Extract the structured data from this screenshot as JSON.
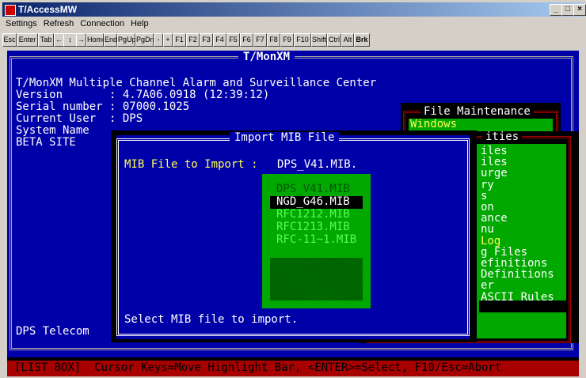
{
  "window": {
    "title": "T/AccessMW",
    "minimize": "_",
    "maximize": "□",
    "close": "×"
  },
  "menu": [
    "Settings",
    "Refresh",
    "Connection",
    "Help"
  ],
  "keys": [
    "Esc",
    "Enter",
    "Tab",
    "←",
    "↕",
    "→",
    "Home",
    "End",
    "PgUp",
    "PgDn",
    "-",
    "+",
    "F1",
    "F2",
    "F3",
    "F4",
    "F5",
    "F6",
    "F7",
    "F8",
    "F9",
    "F10",
    "Shift",
    "Ctrl",
    "Alt",
    "Brk"
  ],
  "screen": {
    "title": "T/MonXM",
    "header": "T/MonXM Multiple Channel Alarm and Surveillance Center",
    "version_label": "Version       : 4.7A06.0918 (12:39:12)",
    "serial_label": "Serial number : 07000.1025",
    "user_label": "Current User  : DPS",
    "system_label": "System Name",
    "site": "BETA SITE",
    "company": "DPS Telecom",
    "status_bar": "[LIST BOX]  Cursor Keys=Move Highlight Bar, <ENTER>=Select, F10/Esc=Abort"
  },
  "file_maintenance": {
    "title": "File Maintenance",
    "selected": "Windows"
  },
  "right_menu": {
    "title": "ities",
    "items": [
      "iles",
      "iles",
      "urge",
      "ry",
      "s",
      "on",
      "ance",
      "nu",
      "Log",
      "g Files",
      "efinitions",
      "Definitions",
      "er",
      "ASCII Rules"
    ],
    "hotkey_index": 8,
    "selected_index": 12
  },
  "dialog": {
    "title": "Import MIB File",
    "field_label": "MIB File to Import :",
    "field_value": "DPS_V41.MIB.",
    "footer": "Select MIB file to import.",
    "files": [
      "DPS_V41.MIB",
      "NGD_G46.MIB",
      "RFC1212.MIB",
      "RFC1213.MIB",
      "RFC-11~1.MIB"
    ],
    "selected_index": 1
  },
  "colors": {
    "blue": "#0000a8",
    "green": "#00a800",
    "darkgreen": "#005800",
    "yellow": "#ffff55",
    "white": "#ffffff",
    "black": "#000000",
    "red": "#a80000",
    "gray": "#a8a8a8"
  }
}
